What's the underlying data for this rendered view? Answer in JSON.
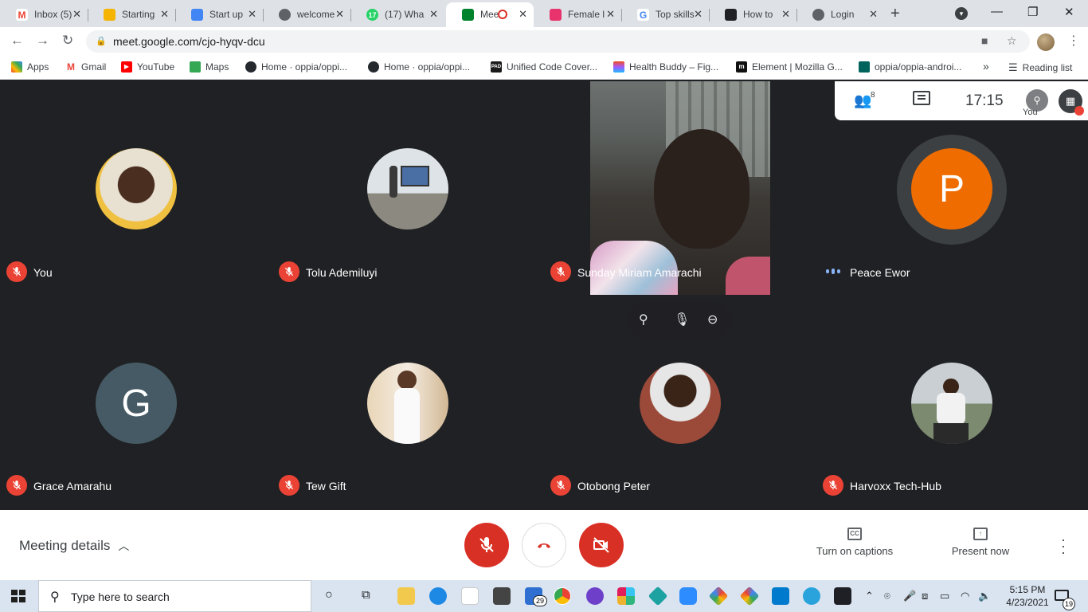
{
  "browser": {
    "tabs": [
      {
        "label": "Inbox (5)",
        "icon": "gmail-icon",
        "color": "#ea4335"
      },
      {
        "label": "Starting",
        "icon": "slides-icon",
        "color": "#f4b400"
      },
      {
        "label": "Start up",
        "icon": "docs-icon",
        "color": "#4285f4"
      },
      {
        "label": "welcome",
        "icon": "globe-icon",
        "color": "#5f6368"
      },
      {
        "label": "(17) Wha",
        "icon": "whatsapp-icon",
        "color": "#25d366",
        "badge": "17"
      },
      {
        "label": "Mee",
        "icon": "meet-icon",
        "color": "#00832d",
        "active": true
      },
      {
        "label": "Female l",
        "icon": "vercel-icon",
        "color": "#e8336d"
      },
      {
        "label": "Top skills",
        "icon": "google-icon",
        "color": "#4285f4"
      },
      {
        "label": "How to",
        "icon": "page-icon",
        "color": "#202124"
      },
      {
        "label": "Login",
        "icon": "globe-icon",
        "color": "#5f6368"
      }
    ],
    "url": "meet.google.com/cjo-hyqv-dcu",
    "bookmarks": [
      {
        "label": "Apps",
        "icon": "apps-grid-icon",
        "color": "#ea4335"
      },
      {
        "label": "Gmail",
        "icon": "gmail-icon",
        "color": "#ea4335"
      },
      {
        "label": "YouTube",
        "icon": "youtube-icon",
        "color": "#ff0000"
      },
      {
        "label": "Maps",
        "icon": "maps-icon",
        "color": "#34a853"
      },
      {
        "label": "Home · oppia/oppi...",
        "icon": "github-icon",
        "color": "#24292e"
      },
      {
        "label": "Home · oppia/oppi...",
        "icon": "github-icon",
        "color": "#24292e"
      },
      {
        "label": "Unified Code Cover...",
        "icon": "pad-icon",
        "color": "#1a1a1a"
      },
      {
        "label": "Health Buddy – Fig...",
        "icon": "figma-icon",
        "color": "#f24e1e"
      },
      {
        "label": "Element | Mozilla G...",
        "icon": "element-icon",
        "color": "#111"
      },
      {
        "label": "oppia/oppia-androi...",
        "icon": "oppia-icon",
        "color": "#00645c"
      }
    ],
    "overflow_label": "»",
    "reading_list": "Reading list"
  },
  "meet": {
    "info": {
      "people_count": "8",
      "time": "17:15",
      "self_label": "You"
    },
    "participants": [
      {
        "name": "You",
        "status": "muted",
        "avatar": "photo",
        "color": "#e0c28a"
      },
      {
        "name": "Tolu Ademiluyi",
        "status": "muted",
        "avatar": "photo",
        "color": "#9aa3a8"
      },
      {
        "name": "Sunday Miriam Amarachi",
        "status": "muted",
        "avatar": "video",
        "color": "#4a4744"
      },
      {
        "name": "Peace Ewor",
        "status": "speaking",
        "avatar": "letter",
        "letter": "P",
        "color": "#ef6c00"
      },
      {
        "name": "Grace Amarahu",
        "status": "muted",
        "avatar": "letter",
        "letter": "G",
        "color": "#455a64"
      },
      {
        "name": "Tew Gift",
        "status": "muted",
        "avatar": "photo",
        "color": "#d7c2a8"
      },
      {
        "name": "Otobong Peter",
        "status": "muted",
        "avatar": "photo",
        "color": "#9b4a3a"
      },
      {
        "name": "Harvoxx Tech-Hub",
        "status": "muted",
        "avatar": "photo",
        "color": "#c9cfd3"
      }
    ],
    "controls": {
      "meeting_details": "Meeting details",
      "captions": "Turn on captions",
      "captions_icon_text": "CC",
      "present": "Present now"
    }
  },
  "taskbar": {
    "search_placeholder": "Type here to search",
    "time": "5:15 PM",
    "date": "4/23/2021",
    "mail_badge": "29",
    "notification_count": "19"
  }
}
